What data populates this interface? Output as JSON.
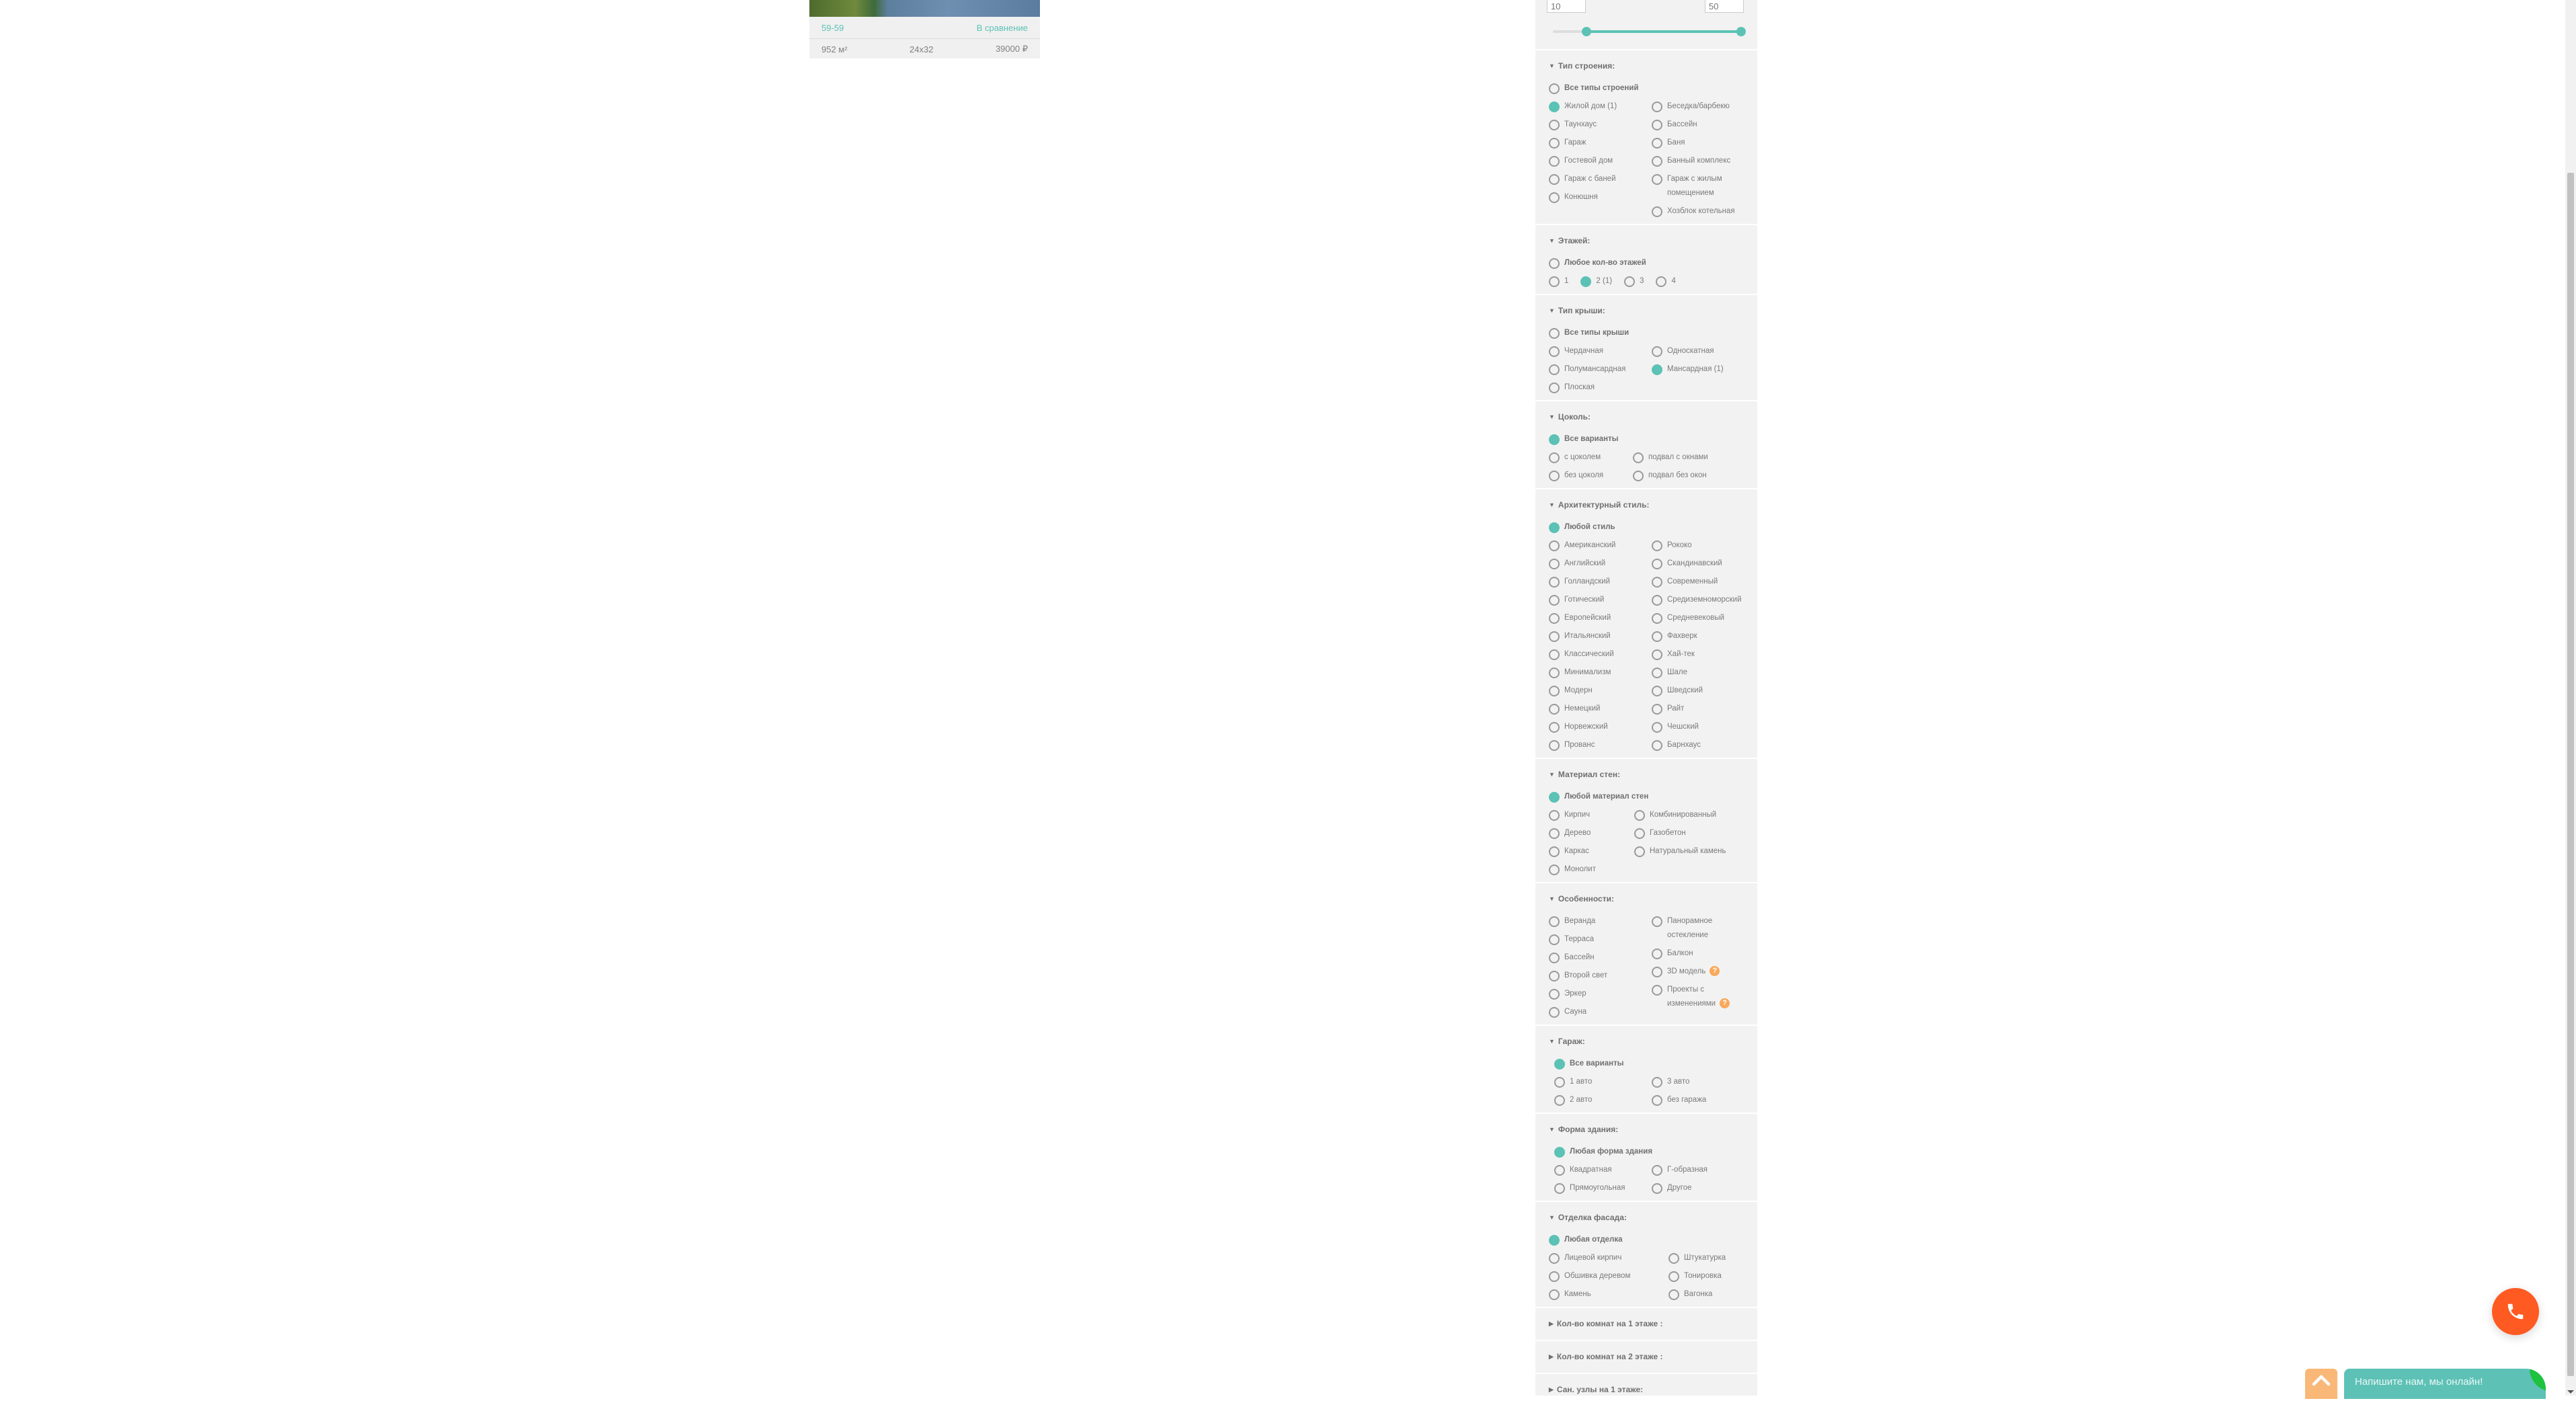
{
  "card": {
    "code": "59-59",
    "compare_link": "В сравнение",
    "area": "952 м²",
    "size": "24x32",
    "price": "39000 ₽"
  },
  "range": {
    "min_value": "10",
    "max_value": "50",
    "slider_min_fraction": 0.18,
    "slider_max_fraction": 1.0
  },
  "colors": {
    "accent": "#5bc2b5",
    "help": "#f9a85a",
    "call": "#ff5a22",
    "up": "#f9b877",
    "chat": "#5dc1b6",
    "panel": "#f2f2f2"
  },
  "sections": [
    {
      "title": "Тип строения:",
      "expanded": true,
      "all": {
        "label": "Все типы строений",
        "checked": false
      },
      "columns": [
        [
          {
            "label": "Жилой дом (1)",
            "checked": true
          },
          {
            "label": "Таунхаус"
          },
          {
            "label": "Гараж"
          },
          {
            "label": "Гостевой дом"
          },
          {
            "label": "Гараж с баней"
          },
          {
            "label": "Конюшня"
          }
        ],
        [
          {
            "label": "Беседка/барбекю"
          },
          {
            "label": "Бассейн"
          },
          {
            "label": "Баня"
          },
          {
            "label": "Банный комплекс"
          },
          {
            "label": "Гараж с жилым помещением"
          },
          {
            "label": "Хозблок котельная"
          }
        ]
      ]
    },
    {
      "title": "Этажей:",
      "expanded": true,
      "all": {
        "label": "Любое кол-во этажей",
        "checked": false
      },
      "inline": [
        {
          "label": "1"
        },
        {
          "label": "2 (1)",
          "checked": true
        },
        {
          "label": "3"
        },
        {
          "label": "4"
        }
      ]
    },
    {
      "title": "Тип крыши:",
      "expanded": true,
      "all": {
        "label": "Все типы крыши",
        "checked": false
      },
      "columns": [
        [
          {
            "label": "Чердачная"
          },
          {
            "label": "Полумансардная"
          },
          {
            "label": "Плоская"
          }
        ],
        [
          {
            "label": "Односкатная"
          },
          {
            "label": "Мансардная (1)",
            "checked": true
          }
        ]
      ]
    },
    {
      "title": "Цоколь:",
      "expanded": true,
      "all": {
        "label": "Все варианты",
        "checked": true
      },
      "columns": [
        [
          {
            "label": "с цоколем"
          },
          {
            "label": "без цоколя"
          }
        ],
        [
          {
            "label": "подвал с окнами"
          },
          {
            "label": "подвал без окон"
          }
        ]
      ]
    },
    {
      "title": "Архитектурный стиль:",
      "expanded": true,
      "all": {
        "label": "Любой стиль",
        "checked": true
      },
      "columns": [
        [
          {
            "label": "Американский"
          },
          {
            "label": "Английский"
          },
          {
            "label": "Голландский"
          },
          {
            "label": "Готический"
          },
          {
            "label": "Европейский"
          },
          {
            "label": "Итальянский"
          },
          {
            "label": "Классический"
          },
          {
            "label": "Минимализм"
          },
          {
            "label": "Модерн"
          },
          {
            "label": "Немецкий"
          },
          {
            "label": "Норвежский"
          },
          {
            "label": "Прованс"
          }
        ],
        [
          {
            "label": "Рококо"
          },
          {
            "label": "Скандинавский"
          },
          {
            "label": "Современный"
          },
          {
            "label": "Средиземноморский"
          },
          {
            "label": "Средневековый"
          },
          {
            "label": "Фахверк"
          },
          {
            "label": "Хай-тек"
          },
          {
            "label": "Шале"
          },
          {
            "label": "Шведский"
          },
          {
            "label": "Райт"
          },
          {
            "label": "Чешский"
          },
          {
            "label": "Барнхаус"
          }
        ]
      ]
    },
    {
      "title": "Материал стен:",
      "expanded": true,
      "all": {
        "label": "Любой материал стен",
        "checked": true
      },
      "columns": [
        [
          {
            "label": "Кирпич"
          },
          {
            "label": "Дерево"
          },
          {
            "label": "Каркас"
          },
          {
            "label": "Монолит"
          }
        ],
        [
          {
            "label": "Комбинированный"
          },
          {
            "label": "Газобетон"
          },
          {
            "label": "Натуральный камень"
          }
        ]
      ]
    },
    {
      "title": "Особенности:",
      "expanded": true,
      "columns": [
        [
          {
            "label": "Веранда"
          },
          {
            "label": "Терраса"
          },
          {
            "label": "Бассейн"
          },
          {
            "label": "Второй свет"
          },
          {
            "label": "Эркер"
          },
          {
            "label": "Сауна"
          }
        ],
        [
          {
            "label": "Панорамное остекление"
          },
          {
            "label": "Балкон"
          },
          {
            "label": "3D модель",
            "help": "?"
          },
          {
            "label": "Проекты с изменениями",
            "help": "?"
          }
        ]
      ]
    },
    {
      "title": "Гараж:",
      "expanded": true,
      "all": {
        "label": "Все варианты",
        "checked": true
      },
      "columns": [
        [
          {
            "label": "1 авто"
          },
          {
            "label": "2 авто"
          }
        ],
        [
          {
            "label": "3 авто"
          },
          {
            "label": "без гаража"
          }
        ]
      ]
    },
    {
      "title": "Форма здания:",
      "expanded": true,
      "all": {
        "label": "Любая форма здания",
        "checked": true
      },
      "columns": [
        [
          {
            "label": "Квадратная"
          },
          {
            "label": "Прямоугольная"
          }
        ],
        [
          {
            "label": "Г-образная"
          },
          {
            "label": "Другое"
          }
        ]
      ]
    },
    {
      "title": "Отделка фасада:",
      "expanded": true,
      "all": {
        "label": "Любая отделка",
        "checked": true
      },
      "columns": [
        [
          {
            "label": "Лицевой кирпич"
          },
          {
            "label": "Обшивка деревом"
          },
          {
            "label": "Камень"
          }
        ],
        [
          {
            "label": "Штукатурка"
          },
          {
            "label": "Тонировка"
          },
          {
            "label": "Вагонка"
          }
        ]
      ]
    },
    {
      "title": "Кол-во комнат на 1 этаже :",
      "expanded": false
    },
    {
      "title": "Кол-во комнат на 2 этаже :",
      "expanded": false
    },
    {
      "title": "Сан. узлы на 1 этаже:",
      "expanded": false
    }
  ],
  "widgets": {
    "chat_label": "Напишите нам, мы онлайн!",
    "call_icon": "phone-icon",
    "up_icon": "chevron-up-icon"
  }
}
